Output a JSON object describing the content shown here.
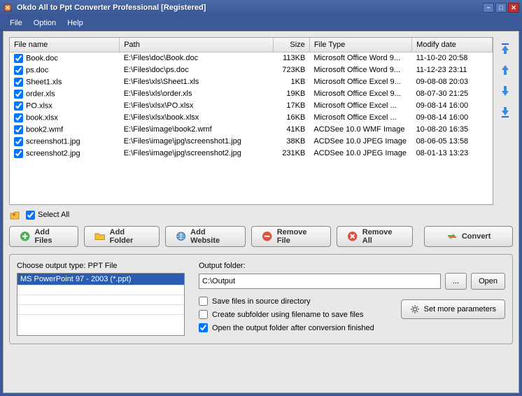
{
  "window": {
    "title": "Okdo All to Ppt Converter Professional [Registered]"
  },
  "menu": {
    "file": "File",
    "option": "Option",
    "help": "Help"
  },
  "columns": {
    "name": "File name",
    "path": "Path",
    "size": "Size",
    "type": "File Type",
    "date": "Modify date"
  },
  "files": [
    {
      "name": "Book.doc",
      "path": "E:\\Files\\doc\\Book.doc",
      "size": "113KB",
      "type": "Microsoft Office Word 9...",
      "date": "11-10-20 20:58"
    },
    {
      "name": "ps.doc",
      "path": "E:\\Files\\doc\\ps.doc",
      "size": "723KB",
      "type": "Microsoft Office Word 9...",
      "date": "11-12-23 23:11"
    },
    {
      "name": "Sheet1.xls",
      "path": "E:\\Files\\xls\\Sheet1.xls",
      "size": "1KB",
      "type": "Microsoft Office Excel 9...",
      "date": "09-08-08 20:03"
    },
    {
      "name": "order.xls",
      "path": "E:\\Files\\xls\\order.xls",
      "size": "19KB",
      "type": "Microsoft Office Excel 9...",
      "date": "08-07-30 21:25"
    },
    {
      "name": "PO.xlsx",
      "path": "E:\\Files\\xlsx\\PO.xlsx",
      "size": "17KB",
      "type": "Microsoft Office Excel ...",
      "date": "09-08-14 16:00"
    },
    {
      "name": "book.xlsx",
      "path": "E:\\Files\\xlsx\\book.xlsx",
      "size": "16KB",
      "type": "Microsoft Office Excel ...",
      "date": "09-08-14 16:00"
    },
    {
      "name": "book2.wmf",
      "path": "E:\\Files\\image\\book2.wmf",
      "size": "41KB",
      "type": "ACDSee 10.0 WMF Image",
      "date": "10-08-20 16:35"
    },
    {
      "name": "screenshot1.jpg",
      "path": "E:\\Files\\image\\jpg\\screenshot1.jpg",
      "size": "38KB",
      "type": "ACDSee 10.0 JPEG Image",
      "date": "08-06-05 13:58"
    },
    {
      "name": "screenshot2.jpg",
      "path": "E:\\Files\\image\\jpg\\screenshot2.jpg",
      "size": "231KB",
      "type": "ACDSee 10.0 JPEG Image",
      "date": "08-01-13 13:23"
    }
  ],
  "selectAll": "Select All",
  "toolbar": {
    "addFiles": "Add Files",
    "addFolder": "Add Folder",
    "addWebsite": "Add Website",
    "removeFile": "Remove File",
    "removeAll": "Remove All",
    "convert": "Convert"
  },
  "bottom": {
    "chooseLabel": "Choose output type:",
    "chooseValue": "PPT File",
    "typeOption": "MS PowerPoint 97 - 2003 (*.ppt)",
    "outputLabel": "Output folder:",
    "outputPath": "C:\\Output",
    "browse": "...",
    "open": "Open",
    "saveSource": "Save files in source directory",
    "createSub": "Create subfolder using filename to save files",
    "openAfter": "Open the output folder after conversion finished",
    "setParams": "Set more parameters"
  }
}
